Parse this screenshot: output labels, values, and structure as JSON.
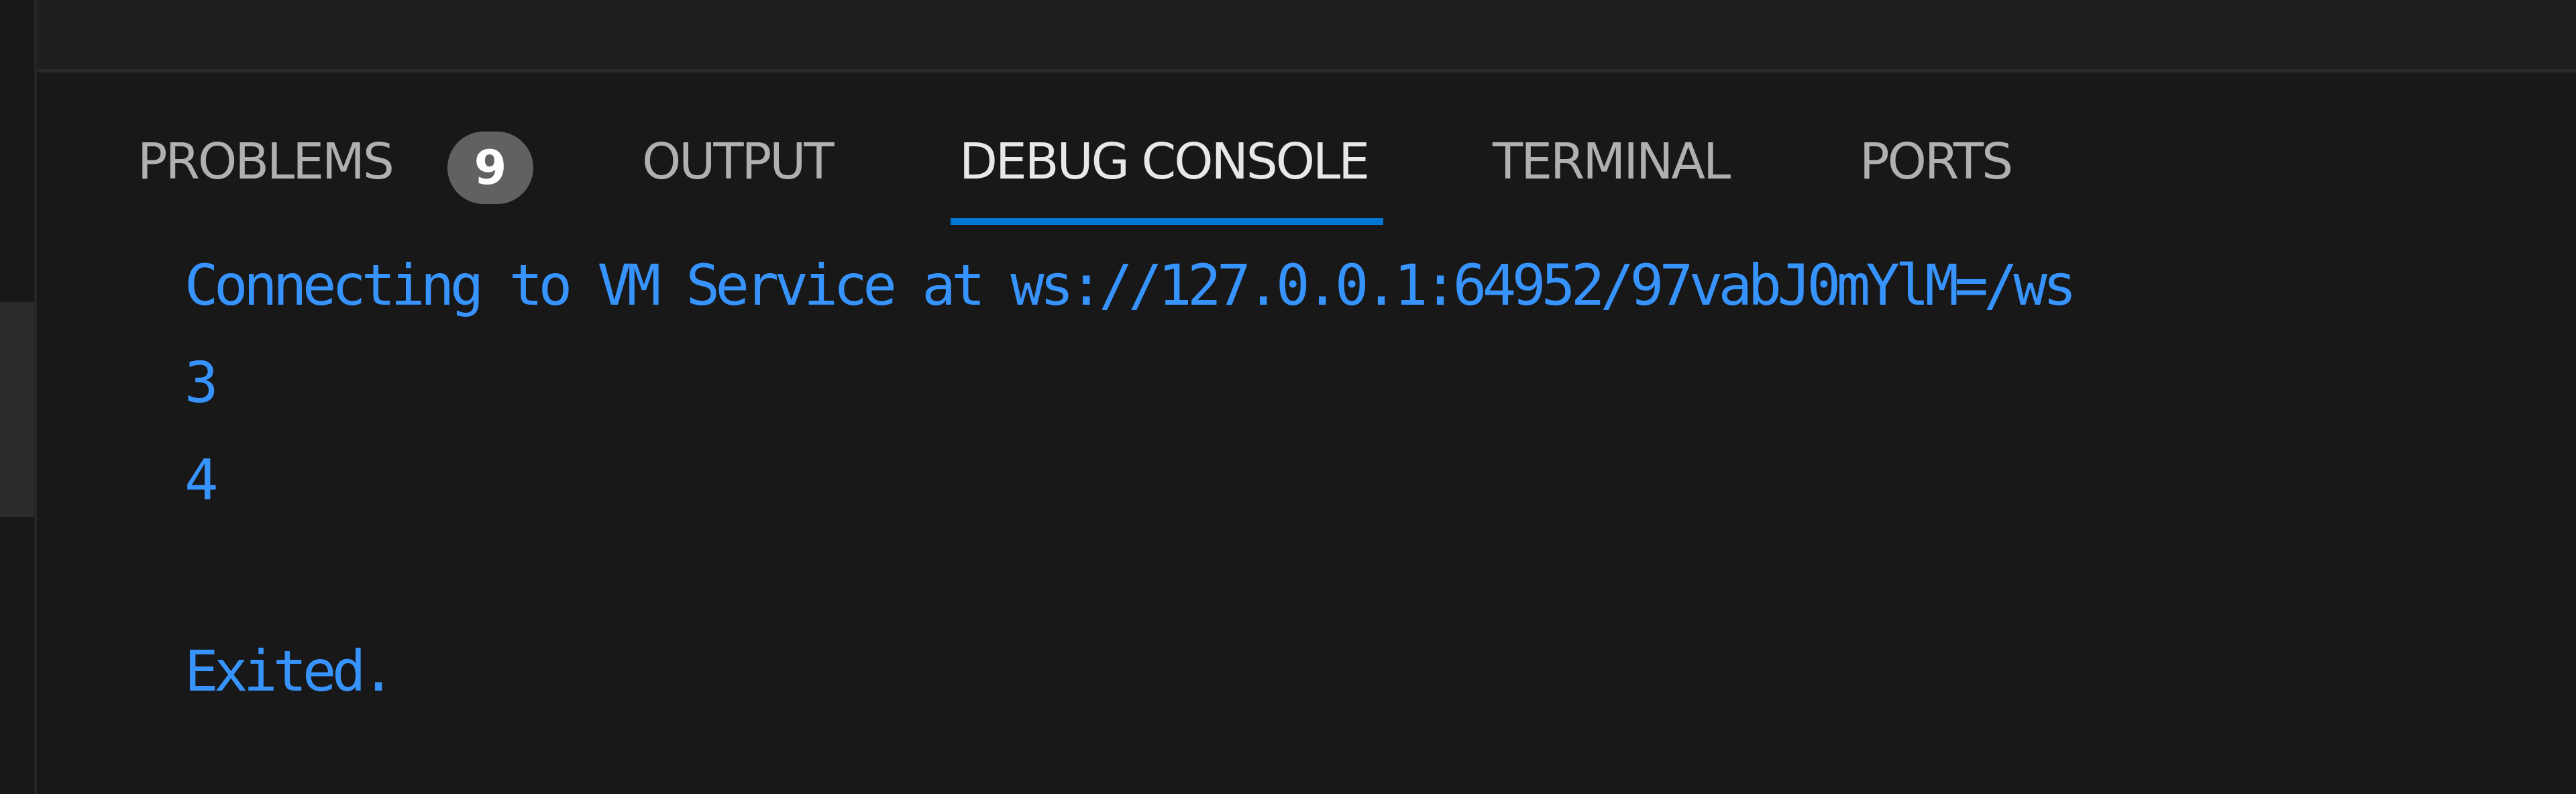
{
  "panel": {
    "tabs": [
      {
        "label": "PROBLEMS",
        "badge": "9",
        "active": false
      },
      {
        "label": "OUTPUT",
        "active": false
      },
      {
        "label": "DEBUG CONSOLE",
        "active": true
      },
      {
        "label": "TERMINAL",
        "active": false
      },
      {
        "label": "PORTS",
        "active": false
      }
    ],
    "accent_color": "#0078d4"
  },
  "debug_console": {
    "text_color": "#3794ff",
    "lines": [
      "Connecting to VM Service at ws://127.0.0.1:64952/97vabJ0mYlM=/ws",
      "3",
      "4",
      "",
      "Exited."
    ]
  }
}
